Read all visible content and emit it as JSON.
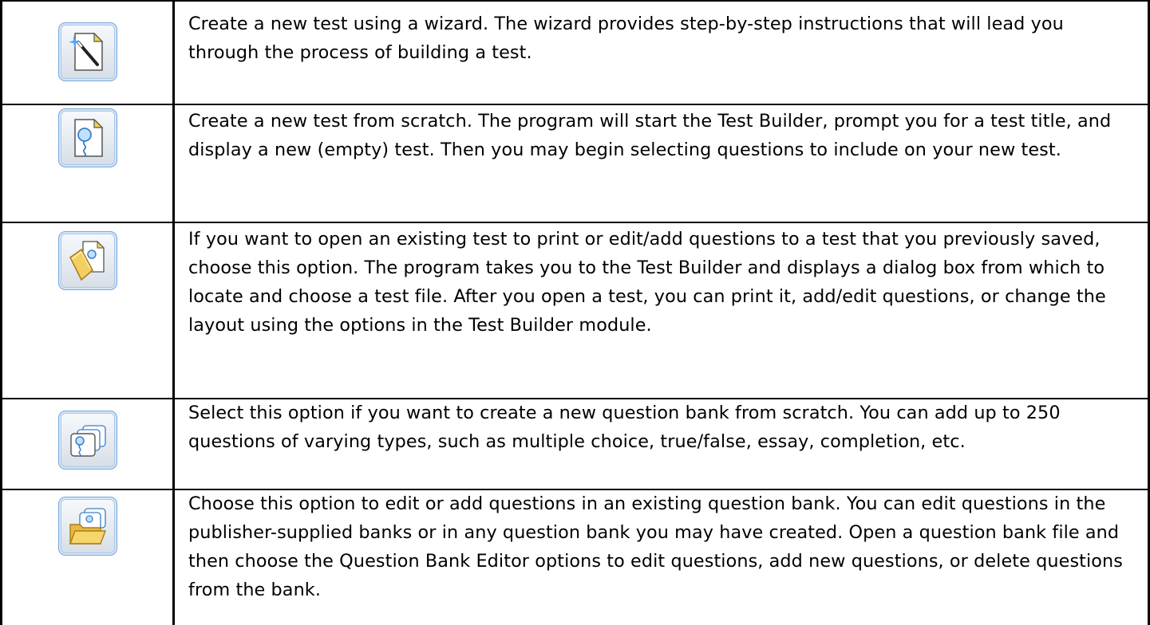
{
  "rows": [
    {
      "icon": "new-test-wizard-icon",
      "text": "Create a new test using a wizard. The wizard provides step-by-step instructions that will lead you through the process of building a test."
    },
    {
      "icon": "new-test-icon",
      "text": "Create a new test from scratch.  The program will start the Test Builder, prompt you for a test title, and display a new (empty) test. Then you may begin selecting questions to include on your new test."
    },
    {
      "icon": "open-test-icon",
      "text": "If you want to open an existing test to print or edit/add questions to a test that you previously saved, choose this option. The program takes you to the Test Builder and displays a dialog box from which to locate and choose a test file. After you open a test, you can print it, add/edit questions, or change the layout using the options in the Test Builder module."
    },
    {
      "icon": "new-question-bank-icon",
      "text": "Select this option if you want to create a new question bank from scratch. You can add up to 250 questions of varying types, such as multiple choice, true/false, essay, completion, etc."
    },
    {
      "icon": "open-question-bank-icon",
      "text": "Choose this option to edit or add questions in an existing question bank. You can edit questions in the publisher-supplied banks or in any question bank you may have created. Open a question bank file and then choose the Question Bank Editor options to edit questions, add new questions, or delete questions from the bank."
    }
  ]
}
